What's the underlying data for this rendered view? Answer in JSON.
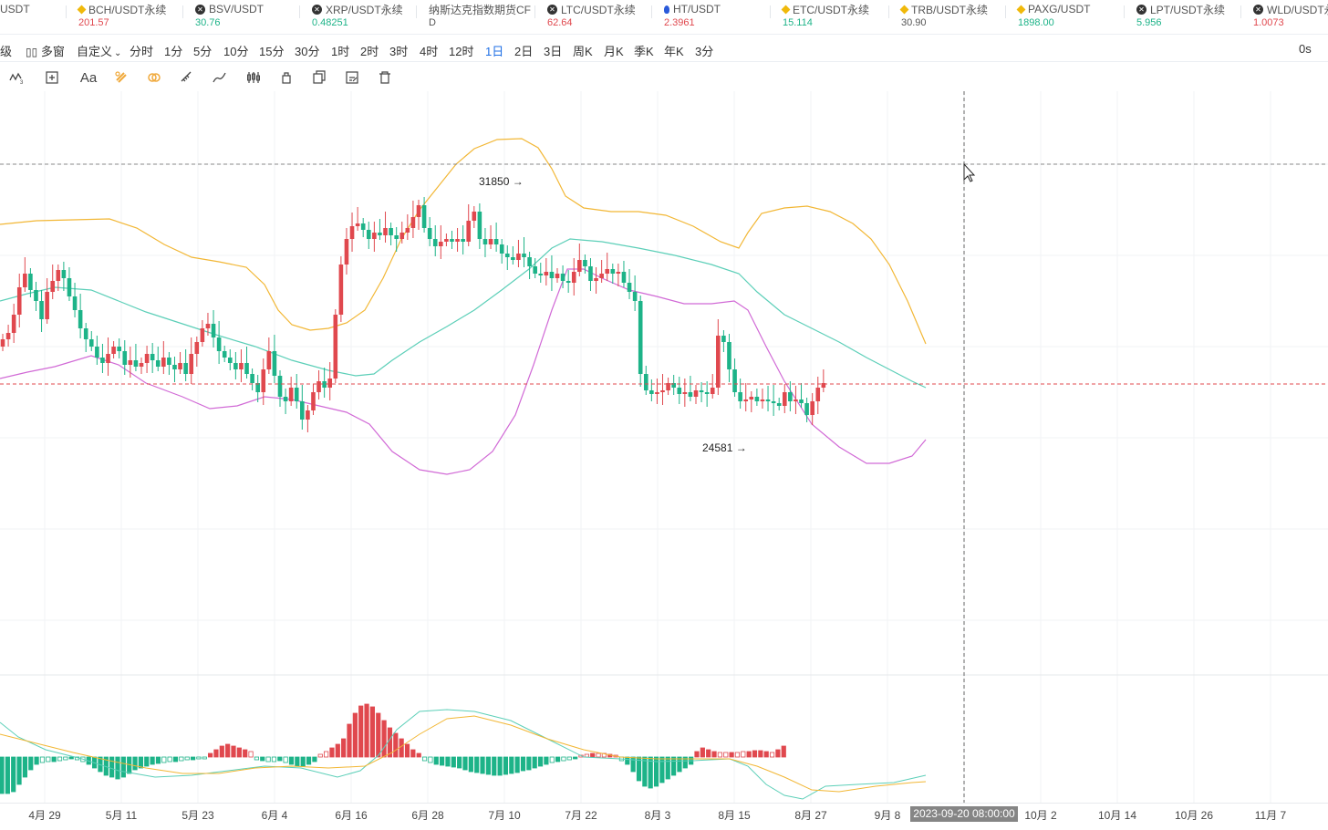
{
  "ticker": [
    {
      "name": "USDT",
      "price": "",
      "icon": "none",
      "priceColor": "#333333"
    },
    {
      "name": "BCH/USDT永续",
      "price": "201.57",
      "icon": "diamond-icon",
      "priceColor": "#e0484e"
    },
    {
      "name": "BSV/USDT",
      "price": "30.76",
      "icon": "coin-x-icon",
      "priceColor": "#1db388"
    },
    {
      "name": "XRP/USDT永续",
      "price": "0.48251",
      "icon": "coin-x-icon",
      "priceColor": "#1db388"
    },
    {
      "name": "纳斯达克指数期货CF",
      "price": "D",
      "icon": "none",
      "priceColor": "#555555"
    },
    {
      "name": "LTC/USDT永续",
      "price": "62.64",
      "icon": "coin-x-icon",
      "priceColor": "#e0484e"
    },
    {
      "name": "HT/USDT",
      "price": "2.3961",
      "icon": "ht-icon",
      "priceColor": "#e0484e"
    },
    {
      "name": "ETC/USDT永续",
      "price": "15.114",
      "icon": "diamond-icon",
      "priceColor": "#1db388"
    },
    {
      "name": "TRB/USDT永续",
      "price": "30.90",
      "icon": "diamond-icon",
      "priceColor": "#555555"
    },
    {
      "name": "PAXG/USDT",
      "price": "1898.00",
      "icon": "diamond-icon",
      "priceColor": "#1db388"
    },
    {
      "name": "LPT/USDT永续",
      "price": "5.956",
      "icon": "coin-x-icon",
      "priceColor": "#1db388"
    },
    {
      "name": "WLD/USDT永续",
      "price": "1.0073",
      "icon": "coin-x-icon",
      "priceColor": "#e0484e"
    }
  ],
  "toolbar": {
    "level_label": "级",
    "multi_window": "多窗",
    "custom": "自定义",
    "intervals": [
      "分时",
      "1分",
      "5分",
      "10分",
      "15分",
      "30分",
      "1时",
      "2时",
      "3时",
      "4时",
      "12时",
      "1日",
      "2日",
      "3日",
      "周K",
      "月K",
      "季K",
      "年K",
      "3分"
    ],
    "active_interval": "1日",
    "right_label": "0s"
  },
  "drawing_tools": [
    "trend-lines-icon",
    "measure-icon",
    "text-tool-icon",
    "magnet-icon",
    "lock-magnet-icon",
    "ruler-icon",
    "brush-icon",
    "pattern-icon",
    "lock-icon",
    "copy-icon",
    "edit-icon",
    "trash-icon"
  ],
  "drawing_text": "Aa",
  "chart": {
    "high_label": "31850",
    "low_label": "24581",
    "x_ticks": [
      "4月 29",
      "5月 11",
      "5月 23",
      "6月 4",
      "6月 16",
      "6月 28",
      "7月 10",
      "7月 22",
      "8月 3",
      "8月 15",
      "8月 27",
      "9月 8",
      "10月 2",
      "10月 14",
      "10月 26",
      "11月 7"
    ],
    "crosshair_time": "2023-09-20 08:00:00",
    "colors": {
      "up": "#e0484e",
      "down": "#1db388",
      "upper_band": "#f2b735",
      "middle_band": "#5ccfb8",
      "lower_band": "#d16ad6",
      "macd_dif": "#5ccfb8",
      "macd_dea": "#f2b735"
    }
  }
}
